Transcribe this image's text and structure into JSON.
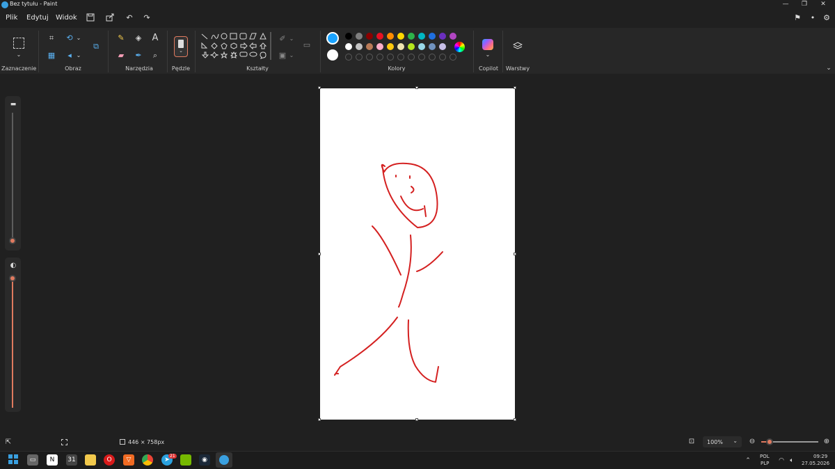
{
  "window": {
    "title": "Bez tytułu - Paint",
    "controls": [
      "—",
      "❐",
      "✕"
    ]
  },
  "menu": {
    "file": "Plik",
    "edit": "Edytuj",
    "view": "Widok"
  },
  "ribbon": {
    "groups": {
      "selection": "Zaznaczenie",
      "image": "Obraz",
      "tools": "Narzędzia",
      "brushes": "Pędzle",
      "shapes": "Kształty",
      "colors": "Kolory",
      "copilot": "Copilot",
      "layers": "Warstwy"
    },
    "colors_row1": [
      "#000000",
      "#7f7f7f",
      "#8b0000",
      "#e81123",
      "#ff8c00",
      "#ffd700",
      "#2db34a",
      "#00b7c3",
      "#1f6fe0",
      "#6b2fbf",
      "#b146c2"
    ],
    "colors_row2": [
      "#ffffff",
      "#c3c3c3",
      "#b97a57",
      "#ffaec9",
      "#ffc90e",
      "#efe4b0",
      "#b5e61d",
      "#99d9ea",
      "#7092be",
      "#c8bfe7"
    ],
    "primary_color": "#1aa3ff",
    "secondary_color": "#ffffff"
  },
  "status": {
    "canvas_size": "446 × 758px",
    "zoom": "100%"
  },
  "taskbar": {
    "lang": "POL",
    "layout": "PLP",
    "time": "09:29",
    "date": "27.05.2026",
    "telegram_badge": "21"
  }
}
